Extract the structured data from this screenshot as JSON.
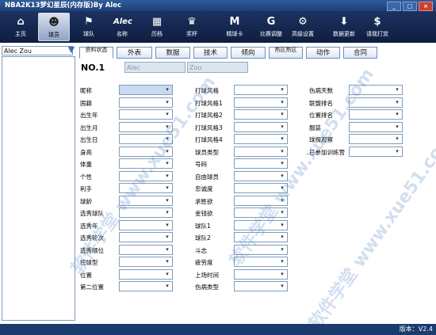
{
  "window": {
    "title": "NBA2K13梦幻星辰(内存版)By Alec",
    "buttons": [
      "_",
      "□",
      "×"
    ]
  },
  "toolbar": [
    {
      "label": "主页",
      "icon": "home-icon",
      "glyph": "⌂"
    },
    {
      "label": "球员",
      "icon": "player-icon",
      "glyph": "☻"
    },
    {
      "label": "球队",
      "icon": "team-icon",
      "glyph": "⚑"
    },
    {
      "label": "名称",
      "icon": "name-icon",
      "glyph": "Alec"
    },
    {
      "label": "历档",
      "icon": "calendar-icon",
      "glyph": "▦"
    },
    {
      "label": "奖杯",
      "icon": "trophy-icon",
      "glyph": "♛"
    },
    {
      "label": "精球卡",
      "icon": "card-icon",
      "glyph": "M"
    },
    {
      "label": "比赛调整",
      "icon": "gatorade-icon",
      "glyph": "G"
    },
    {
      "label": "高级设置",
      "icon": "gear-icon",
      "glyph": "⚙"
    },
    {
      "label": "数据更新",
      "icon": "download-icon",
      "glyph": "⬇"
    },
    {
      "label": "请我打赏",
      "icon": "dollar-icon",
      "glyph": "$"
    }
  ],
  "sidebar": {
    "search_value": "Alec Zou"
  },
  "tabs": [
    "资料状态",
    "外表",
    "数据",
    "技术",
    "倾向",
    "热区热区",
    "动作",
    "合同"
  ],
  "player": {
    "no_label": "NO.1",
    "first_name": "Alec",
    "last_name": "Zou"
  },
  "fields": {
    "col1": [
      "昵称",
      "国籍",
      "出生年",
      "出生月",
      "出生日",
      "身高",
      "体重",
      "个性",
      "利手",
      "球龄",
      "选秀球队",
      "选秀年",
      "选秀轮次",
      "选秀顺位",
      "控球型",
      "位置",
      "第二位置"
    ],
    "col2": [
      "打球风格",
      "打球风格1",
      "打球风格2",
      "打球风格3",
      "打球风格4",
      "球员类型",
      "号码",
      "自由球员",
      "忠诚度",
      "求胜欲",
      "金钱欲",
      "球队1",
      "球队2",
      "斗志",
      "疲劳度",
      "上场时间",
      "伤病类型"
    ],
    "col3": [
      "伤病天数",
      "联盟排名",
      "位置排名",
      "服装",
      "球探观察",
      "已参加训练营"
    ]
  },
  "status": {
    "version": "版本：V2.4"
  },
  "watermark": "软件学堂 www.xue51.com"
}
